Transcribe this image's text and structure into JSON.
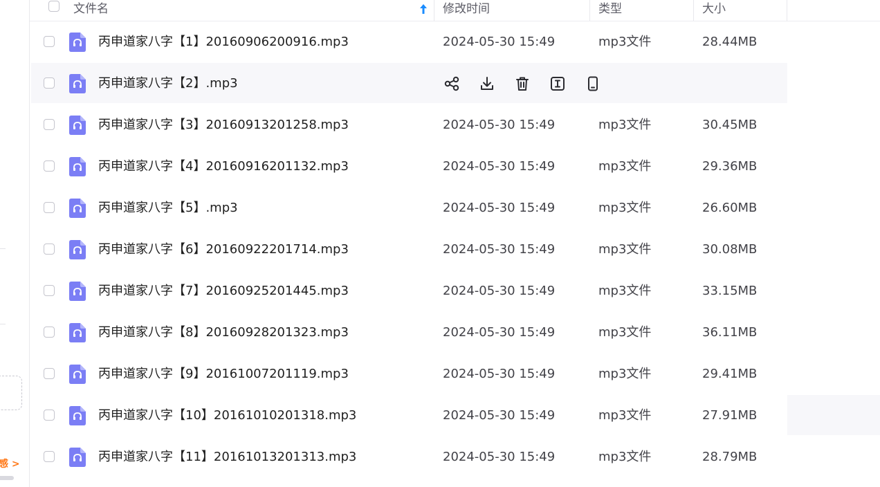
{
  "header": {
    "name_label": "文件名",
    "time_label": "修改时间",
    "type_label": "类型",
    "size_label": "大小"
  },
  "left_panel": {
    "promo_text": "感 >"
  },
  "colors": {
    "accent": "#1a8cff",
    "file_icon": "#7b7ef5",
    "hover_row": "#f7f7fa",
    "promo": "#ff7a1a"
  },
  "hover_actions": [
    "share-icon",
    "download-icon",
    "delete-icon",
    "rename-icon",
    "phone-icon"
  ],
  "files": [
    {
      "name": "丙申道家八字【1】20160906200916.mp3",
      "time": "2024-05-30 15:49",
      "type": "mp3文件",
      "size": "28.44MB"
    },
    {
      "name": "丙申道家八字【2】.mp3",
      "time": "",
      "type": "",
      "size": ""
    },
    {
      "name": "丙申道家八字【3】20160913201258.mp3",
      "time": "2024-05-30 15:49",
      "type": "mp3文件",
      "size": "30.45MB"
    },
    {
      "name": "丙申道家八字【4】20160916201132.mp3",
      "time": "2024-05-30 15:49",
      "type": "mp3文件",
      "size": "29.36MB"
    },
    {
      "name": "丙申道家八字【5】.mp3",
      "time": "2024-05-30 15:49",
      "type": "mp3文件",
      "size": "26.60MB"
    },
    {
      "name": "丙申道家八字【6】20160922201714.mp3",
      "time": "2024-05-30 15:49",
      "type": "mp3文件",
      "size": "30.08MB"
    },
    {
      "name": "丙申道家八字【7】20160925201445.mp3",
      "time": "2024-05-30 15:49",
      "type": "mp3文件",
      "size": "33.15MB"
    },
    {
      "name": "丙申道家八字【8】20160928201323.mp3",
      "time": "2024-05-30 15:49",
      "type": "mp3文件",
      "size": "36.11MB"
    },
    {
      "name": "丙申道家八字【9】20161007201119.mp3",
      "time": "2024-05-30 15:49",
      "type": "mp3文件",
      "size": "29.41MB"
    },
    {
      "name": "丙申道家八字【10】20161010201318.mp3",
      "time": "2024-05-30 15:49",
      "type": "mp3文件",
      "size": "27.91MB"
    },
    {
      "name": "丙申道家八字【11】20161013201313.mp3",
      "time": "2024-05-30 15:49",
      "type": "mp3文件",
      "size": "28.79MB"
    }
  ]
}
